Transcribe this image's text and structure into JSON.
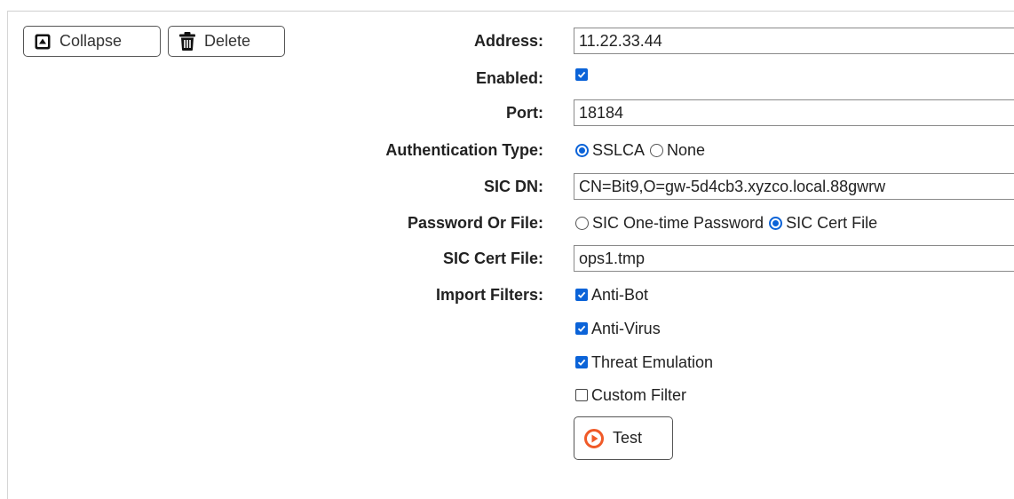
{
  "toolbar": {
    "collapse_label": "Collapse",
    "delete_label": "Delete"
  },
  "form": {
    "address": {
      "label": "Address:",
      "value": "11.22.33.44"
    },
    "enabled": {
      "label": "Enabled:",
      "checked": true
    },
    "port": {
      "label": "Port:",
      "value": "18184"
    },
    "auth_type": {
      "label": "Authentication Type:",
      "options": [
        {
          "label": "SSLCA",
          "selected": true
        },
        {
          "label": "None",
          "selected": false
        }
      ]
    },
    "sic_dn": {
      "label": "SIC DN:",
      "value": "CN=Bit9,O=gw-5d4cb3.xyzco.local.88gwrw"
    },
    "password_or_file": {
      "label": "Password Or File:",
      "options": [
        {
          "label": "SIC One-time Password",
          "selected": false
        },
        {
          "label": "SIC Cert File",
          "selected": true
        }
      ]
    },
    "sic_cert_file": {
      "label": "SIC Cert File:",
      "value": "ops1.tmp"
    },
    "import_filters": {
      "label": "Import Filters:",
      "items": [
        {
          "label": "Anti-Bot",
          "checked": true
        },
        {
          "label": "Anti-Virus",
          "checked": true
        },
        {
          "label": "Threat Emulation",
          "checked": true
        },
        {
          "label": "Custom Filter",
          "checked": false
        }
      ]
    },
    "test_label": "Test"
  },
  "colors": {
    "accent": "#0b63d8",
    "test_icon": "#f05a28"
  },
  "icons": {
    "collapse": "collapse-icon",
    "delete": "trash-icon",
    "test": "play-circle-icon",
    "check": "checkmark"
  }
}
